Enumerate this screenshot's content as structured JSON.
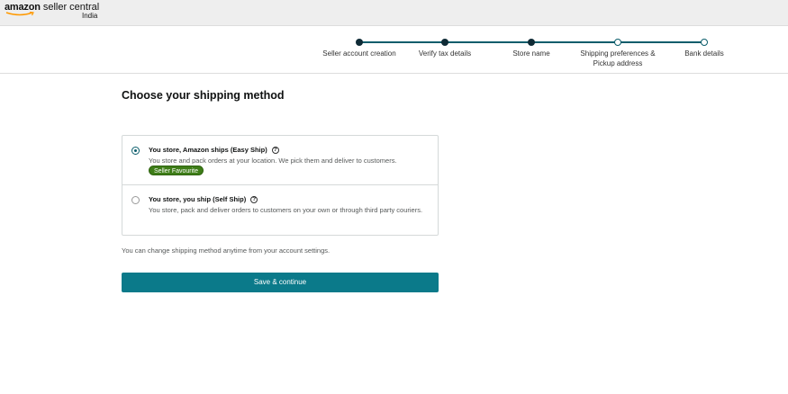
{
  "header": {
    "logo_amazon": "amazon",
    "logo_rest": " seller central",
    "logo_sub": "India"
  },
  "progress": {
    "steps": [
      {
        "label": "Seller account creation",
        "status": "done"
      },
      {
        "label": "Verify tax details",
        "status": "done"
      },
      {
        "label": "Store name",
        "status": "done"
      },
      {
        "label": "Shipping preferences &\nPickup address",
        "status": "current"
      },
      {
        "label": "Bank details",
        "status": "todo"
      }
    ]
  },
  "page": {
    "title": "Choose your shipping method",
    "note": "You can change shipping method anytime from your account settings.",
    "save_label": "Save & continue"
  },
  "options": [
    {
      "title": "You store, Amazon ships (Easy Ship)",
      "description": "You store and pack orders at your location. We pick them and deliver to customers.",
      "badge": "Seller Favourite",
      "selected": true
    },
    {
      "title": "You store, you ship (Self Ship)",
      "description": "You store, pack and deliver orders to customers on your own or through third party couriers.",
      "selected": false
    }
  ],
  "colors": {
    "primary": "#0b7a8a",
    "track": "#0b5d6b",
    "badge": "#3e7d18"
  }
}
